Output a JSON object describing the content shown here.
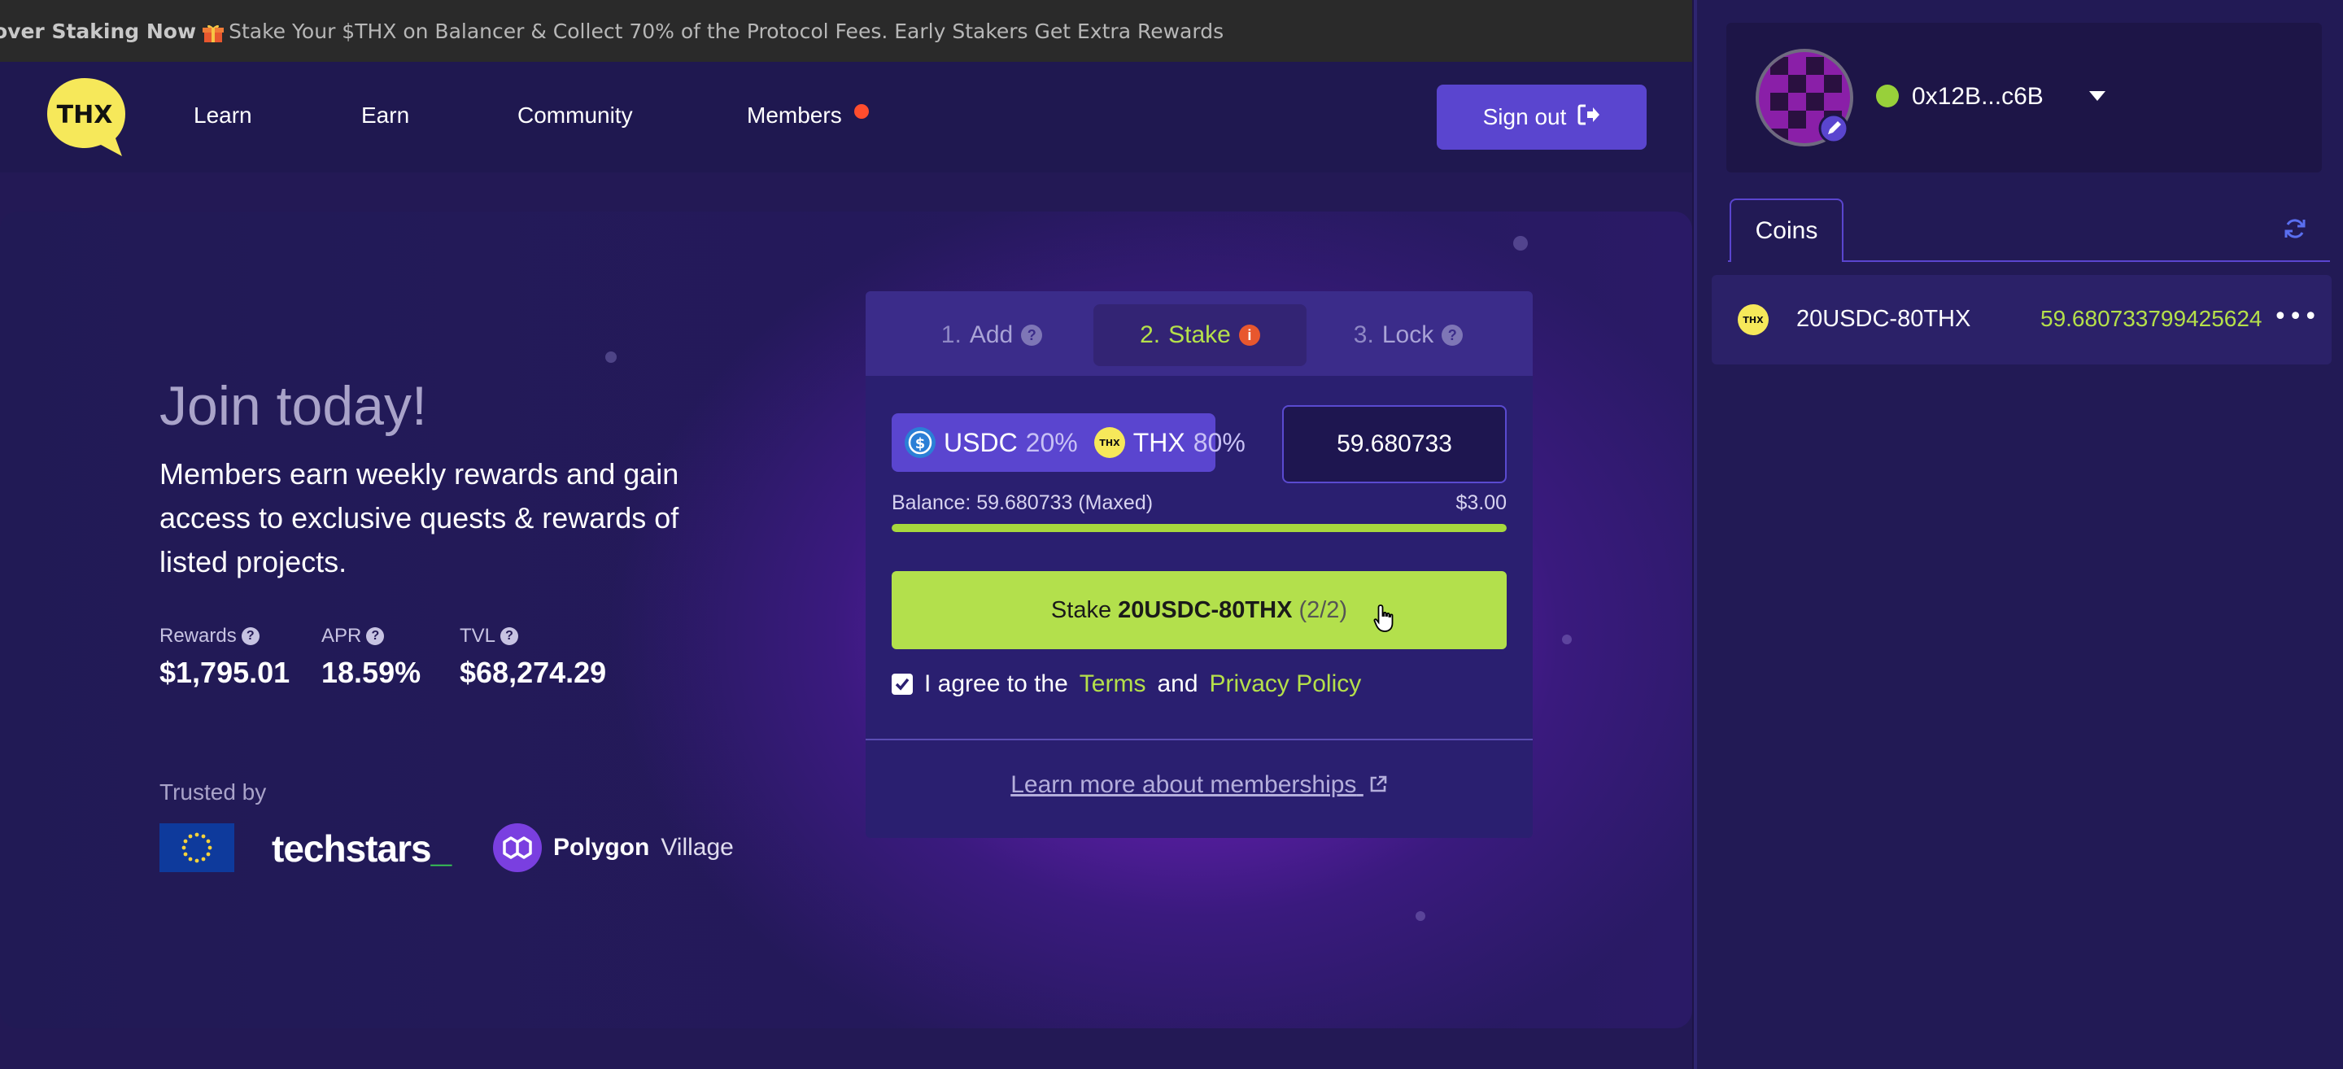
{
  "ticker": {
    "lead": "over Staking Now",
    "text": "Stake Your $THX on Balancer & Collect 70% of the Protocol Fees. Early Stakers Get Extra Rewards"
  },
  "nav": {
    "logo_text": "THX",
    "links": [
      "Learn",
      "Earn",
      "Community",
      "Members"
    ],
    "sign_out": "Sign out"
  },
  "hero": {
    "title": "Join today!",
    "description": "Members earn weekly rewards and gain access to exclusive quests & rewards of listed projects.",
    "stats": [
      {
        "label": "Rewards",
        "value": "$1,795.01"
      },
      {
        "label": "APR",
        "value": "18.59%"
      },
      {
        "label": "TVL",
        "value": "$68,274.29"
      }
    ],
    "trusted_label": "Trusted by",
    "partners": {
      "techstars": "techstars",
      "techstars_suffix": "_",
      "polygon_bold": "Polygon",
      "polygon_rest": "Village"
    }
  },
  "stake_card": {
    "steps": [
      {
        "num": "1.",
        "label": "Add"
      },
      {
        "num": "2.",
        "label": "Stake"
      },
      {
        "num": "3.",
        "label": "Lock"
      }
    ],
    "pair": {
      "token1": "USDC",
      "pct1": "20%",
      "token2": "THX",
      "pct2": "80%",
      "thx_icon_text": "THX"
    },
    "amount": "59.680733",
    "balance_label": "Balance: 59.680733 (Maxed)",
    "balance_usd": "$3.00",
    "balance_fill_fraction": 1.0,
    "button": {
      "prefix": "Stake",
      "token": "20USDC-80THX",
      "count": "(2/2)"
    },
    "agree": {
      "pre": "I agree to the",
      "terms": "Terms",
      "and": "and",
      "privacy": "Privacy Policy",
      "checked": true
    },
    "learn_more": "Learn more about memberships"
  },
  "wallet": {
    "address": "0x12B...c6B",
    "status_color": "#98d03a",
    "tabs": [
      "Coins"
    ],
    "coins": [
      {
        "name": "20USDC-80THX",
        "balance": "59.680733799425624",
        "icon_text": "THX"
      }
    ],
    "more": "•••"
  },
  "colors": {
    "accent_green": "#b3e04c",
    "accent_purple": "#5a45cf",
    "notification": "#ff4d2e"
  }
}
